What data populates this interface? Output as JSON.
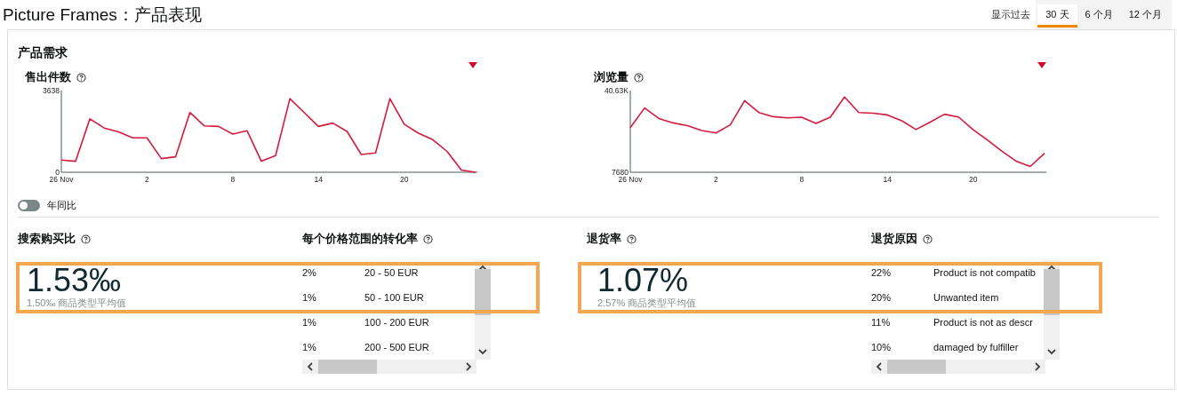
{
  "header": {
    "title": "Picture Frames：产品表现",
    "range_label": "显示过去",
    "range_tabs": [
      {
        "label": "30 天",
        "selected": true
      },
      {
        "label": "6 个月",
        "selected": false
      },
      {
        "label": "12 个月",
        "selected": false
      }
    ]
  },
  "demand": {
    "title": "产品需求",
    "charts": [
      {
        "title": "售出件数",
        "chart_data": {
          "type": "line",
          "categories": [
            "26 Nov",
            null,
            null,
            null,
            null,
            null,
            "2",
            null,
            null,
            null,
            null,
            null,
            "8",
            null,
            null,
            null,
            null,
            null,
            "14",
            null,
            null,
            null,
            null,
            null,
            "20",
            null,
            null,
            null,
            null,
            null
          ],
          "ylim": [
            0,
            3638
          ],
          "yticks": [
            0,
            3638
          ],
          "series": [
            {
              "color": "#d6193c",
              "values": [
                540,
                490,
                2380,
                1970,
                1800,
                1530,
                1530,
                610,
                690,
                2660,
                2070,
                2040,
                1700,
                1850,
                490,
                740,
                3280,
                2660,
                2040,
                2190,
                1820,
                790,
                860,
                3280,
                2140,
                1740,
                1450,
                930,
                100,
                0
              ]
            }
          ]
        }
      },
      {
        "title": "浏览量",
        "chart_data": {
          "type": "line",
          "categories": [
            "26 Nov",
            null,
            null,
            null,
            null,
            null,
            "2",
            null,
            null,
            null,
            null,
            null,
            "8",
            null,
            null,
            null,
            null,
            null,
            "14",
            null,
            null,
            null,
            null,
            null,
            "20",
            null,
            null,
            null,
            null,
            null
          ],
          "ylim": [
            7680,
            40630
          ],
          "yticks": [
            {
              "value": 7680,
              "label": "7680"
            },
            {
              "value": 40630,
              "label": "40.63K"
            }
          ],
          "series": [
            {
              "color": "#d6193c",
              "values": [
                25700,
                33600,
                29400,
                27600,
                26500,
                24500,
                23500,
                26800,
                36600,
                31800,
                30100,
                29600,
                29900,
                27400,
                29900,
                38000,
                31800,
                31500,
                30800,
                28500,
                24900,
                27900,
                31100,
                29900,
                24800,
                20700,
                16200,
                12200,
                10000,
                15300
              ]
            }
          ]
        }
      }
    ],
    "yoy_toggle": {
      "label": "年同比",
      "on": false
    }
  },
  "metrics": [
    {
      "kind": "stat",
      "title": "搜索购买比",
      "value": "1.53‰",
      "average": "1.50‰ 商品类型平均值",
      "highlighted": true
    },
    {
      "kind": "table",
      "title": "每个价格范围的转化率",
      "rows": [
        {
          "share": "2%",
          "label": "20 - 50 EUR"
        },
        {
          "share": "1%",
          "label": "50 - 100 EUR"
        },
        {
          "share": "1%",
          "label": "100 - 200 EUR"
        },
        {
          "share": "1%",
          "label": "200 - 500 EUR"
        }
      ]
    },
    {
      "kind": "stat",
      "title": "退货率",
      "value": "1.07%",
      "average": "2.57% 商品类型平均值",
      "highlighted": true
    },
    {
      "kind": "table",
      "title": "退货原因",
      "rows": [
        {
          "share": "22%",
          "label": "Product is not compatib"
        },
        {
          "share": "20%",
          "label": "Unwanted item"
        },
        {
          "share": "11%",
          "label": "Product is not as descr"
        },
        {
          "share": "10%",
          "label": "damaged by fulfiller"
        }
      ]
    }
  ]
}
